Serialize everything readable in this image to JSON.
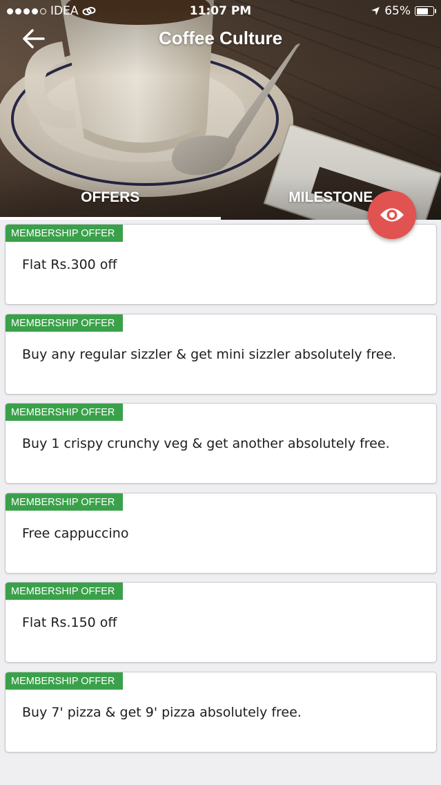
{
  "status_bar": {
    "carrier": "IDEA",
    "time": "11:07 PM",
    "battery": "65%",
    "battery_level": 0.65,
    "signal_bars": 4
  },
  "nav": {
    "title": "Coffee Culture",
    "back_icon": "arrow-left-icon"
  },
  "tabs": [
    {
      "label": "OFFERS",
      "active": true
    },
    {
      "label": "MILESTONE",
      "active": false
    }
  ],
  "fab": {
    "icon": "eye-icon",
    "color": "#e05350"
  },
  "colors": {
    "badge": "#3aa14a",
    "fab": "#e05350",
    "background": "#efeff1"
  },
  "offers": [
    {
      "badge": "MEMBERSHIP OFFER",
      "text": "Flat Rs.300 off"
    },
    {
      "badge": "MEMBERSHIP OFFER",
      "text": "Buy any regular sizzler & get mini sizzler absolutely free."
    },
    {
      "badge": "MEMBERSHIP OFFER",
      "text": "Buy 1 crispy crunchy veg & get another absolutely free."
    },
    {
      "badge": "MEMBERSHIP OFFER",
      "text": "Free cappuccino"
    },
    {
      "badge": "MEMBERSHIP OFFER",
      "text": "Flat Rs.150 off"
    },
    {
      "badge": "MEMBERSHIP OFFER",
      "text": "Buy 7' pizza & get 9' pizza absolutely free."
    }
  ]
}
